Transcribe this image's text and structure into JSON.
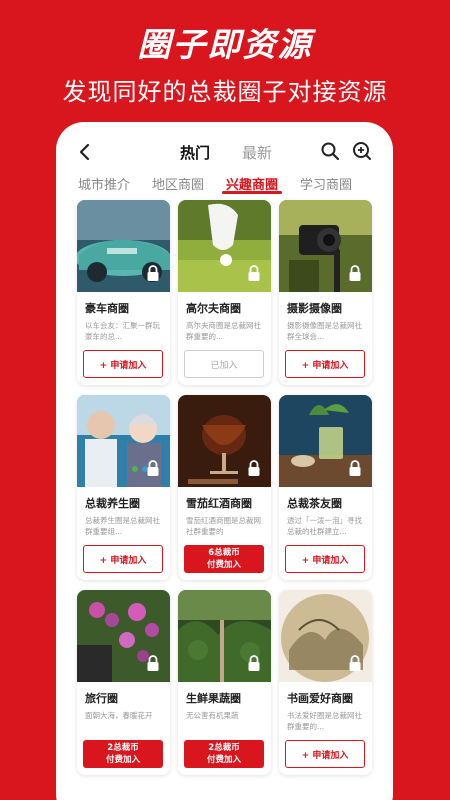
{
  "hero": {
    "title": "圈子即资源",
    "subtitle": "发现同好的总裁圈子对接资源"
  },
  "topbar": {
    "tab_hot": "热门",
    "tab_new": "最新"
  },
  "categories": [
    "城市推介",
    "地区商圈",
    "兴趣商圈",
    "学习商圈"
  ],
  "active_category": "兴趣商圈",
  "cards": [
    {
      "title": "豪车商圈",
      "desc": "以车会友：汇聚一群玩豪车的总...",
      "btn": "+ 申请加入",
      "btn2": ""
    },
    {
      "title": "高尔夫商圈",
      "desc": "高尔夫商圈是总裁网社群重要的...",
      "btn": "已加入",
      "btn2": ""
    },
    {
      "title": "摄影摄像圈",
      "desc": "摄影摄像圈是总裁网社群全球会...",
      "btn": "+ 申请加入",
      "btn2": ""
    },
    {
      "title": "总裁养生圈",
      "desc": "总裁养生圈是总裁网社群重要组...",
      "btn": "+ 申请加入",
      "btn2": ""
    },
    {
      "title": "雪茄红酒商圈",
      "desc": "雪茄红酒商圈是总裁网社群重要的",
      "btn": "6总裁币",
      "btn2": "付费加入"
    },
    {
      "title": "总裁茶友圈",
      "desc": "透过「一泼一泡」寻找总裁的社群建立...",
      "btn": "+ 申请加入",
      "btn2": ""
    },
    {
      "title": "旅行圈",
      "desc": "面朝大海，春暖花开",
      "btn": "2总裁币",
      "btn2": "付费加入"
    },
    {
      "title": "生鲜果蔬圈",
      "desc": "无公害有机果蔬",
      "btn": "2总裁币",
      "btn2": "付费加入"
    },
    {
      "title": "书画爱好商圈",
      "desc": "书法爱好圈是总裁网社群重要的...",
      "btn": "+ 申请加入",
      "btn2": ""
    }
  ],
  "icons": [
    "back-icon",
    "search-icon",
    "add-circle-icon",
    "lock-icon"
  ],
  "colors": {
    "brand": "#d9151e"
  }
}
